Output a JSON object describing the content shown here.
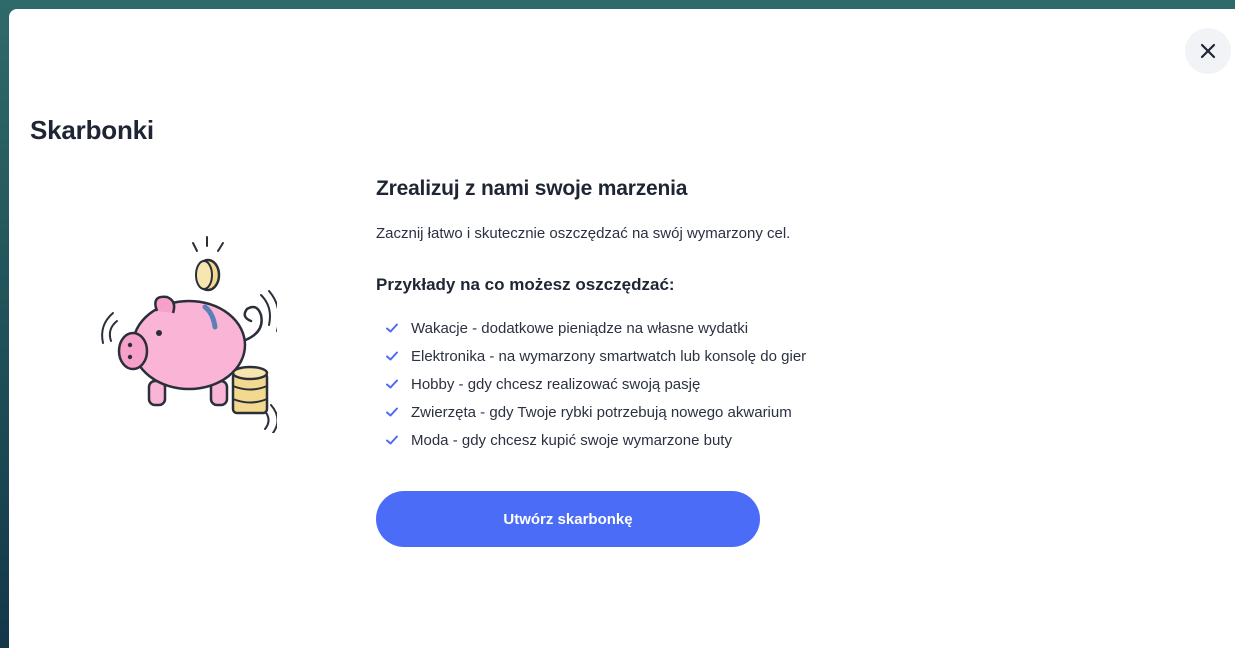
{
  "modal": {
    "title": "Skarbonki",
    "close_icon": "close-icon"
  },
  "illustration": {
    "icon": "piggy-bank-icon",
    "colors": {
      "pig": "#f9b4d6",
      "coin": "#f3d98f",
      "outline": "#2b2f3a"
    }
  },
  "content": {
    "heading": "Zrealizuj z nami swoje marzenia",
    "intro": "Zacznij łatwo i skutecznie oszczędzać na swój wymarzony cel.",
    "examples_heading": "Przykłady na co możesz oszczędzać:",
    "examples": [
      {
        "text": "Wakacje - dodatkowe pieniądze na własne wydatki"
      },
      {
        "text": "Elektronika - na wymarzony smartwatch lub konsolę do gier"
      },
      {
        "text": "Hobby - gdy chcesz realizować swoją pasję"
      },
      {
        "text": "Zwierzęta - gdy Twoje rybki potrzebują nowego akwarium"
      },
      {
        "text": "Moda - gdy chcesz kupić swoje wymarzone buty"
      }
    ]
  },
  "cta": {
    "label": "Utwórz skarbonkę"
  },
  "colors": {
    "accent": "#4a6cf7",
    "check": "#4a6cf7",
    "text": "#1f2533"
  }
}
